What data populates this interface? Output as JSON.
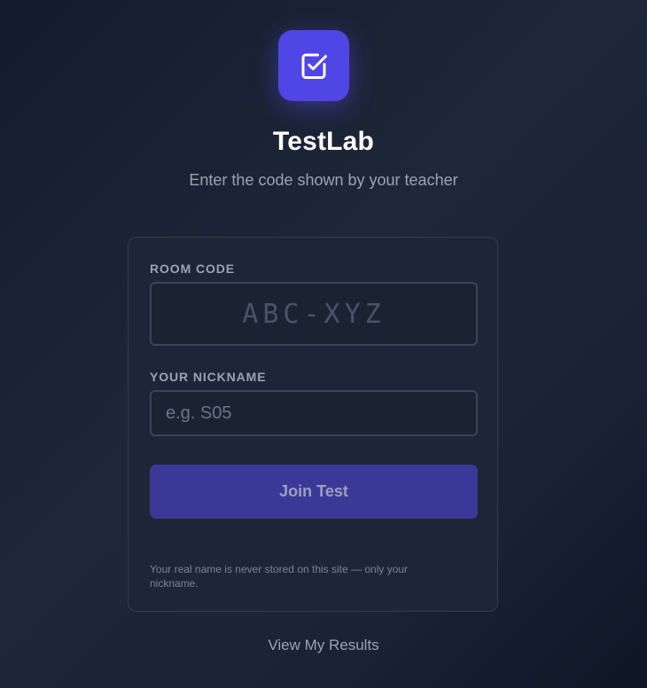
{
  "app": {
    "title": "TestLab",
    "subtitle": "Enter the code shown by your teacher",
    "logo_icon": "checkbox-icon",
    "accent_color": "#5046e5"
  },
  "form": {
    "room_code": {
      "label": "ROOM CODE",
      "placeholder": "ABC-XYZ",
      "value": ""
    },
    "nickname": {
      "label": "YOUR NICKNAME",
      "placeholder": "e.g. S05",
      "value": ""
    },
    "submit_label": "Join Test",
    "privacy_note": "Your real name is never stored on this site — only your nickname."
  },
  "footer": {
    "results_link": "View My Results"
  }
}
